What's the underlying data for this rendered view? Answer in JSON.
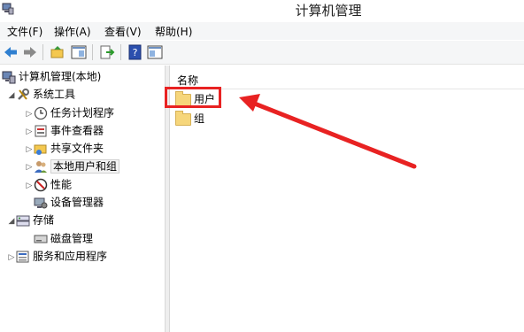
{
  "window": {
    "title": "计算机管理"
  },
  "menu": [
    "文件(F)",
    "操作(A)",
    "查看(V)",
    "帮助(H)"
  ],
  "tree": {
    "root": "计算机管理(本地)",
    "system_tools": "系统工具",
    "task_scheduler": "任务计划程序",
    "event_viewer": "事件查看器",
    "shared_folders": "共享文件夹",
    "local_users_groups": "本地用户和组",
    "performance": "性能",
    "device_manager": "设备管理器",
    "storage": "存储",
    "disk_management": "磁盘管理",
    "services_apps": "服务和应用程序"
  },
  "list": {
    "column_name": "名称",
    "items": [
      "用户",
      "组"
    ]
  },
  "colors": {
    "highlight": "#e82222",
    "folder": "#f6d67b"
  }
}
